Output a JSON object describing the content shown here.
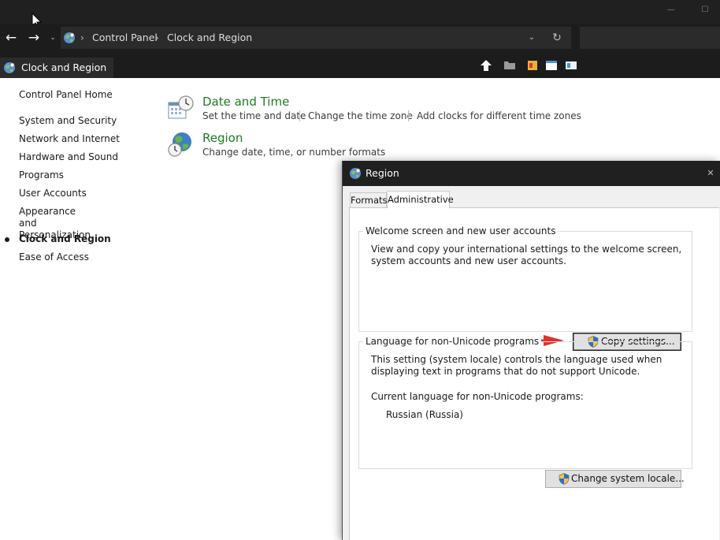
{
  "titlebar": {
    "minimize_glyph": "—",
    "maximize_glyph": "☐"
  },
  "nav": {
    "back_glyph": "←",
    "forward_glyph": "→",
    "recent_glyph": "⌄"
  },
  "address": {
    "icon": "control-panel-globe-icon",
    "separator": "›",
    "crumbs": [
      "Control Panel",
      "Clock and Region"
    ],
    "dropdown_glyph": "⌄",
    "refresh_glyph": "↻"
  },
  "tab": {
    "label": "Clock and Region",
    "icon": "control-panel-globe-icon"
  },
  "toolbar_icons": [
    "up-arrow-icon",
    "folder-icon",
    "flag-icon",
    "window-icon",
    "panel-icon"
  ],
  "sidebar": {
    "items": [
      {
        "label": "Control Panel Home",
        "current": false
      },
      {
        "label": "System and Security",
        "current": false
      },
      {
        "label": "Network and Internet",
        "current": false
      },
      {
        "label": "Hardware and Sound",
        "current": false
      },
      {
        "label": "Programs",
        "current": false
      },
      {
        "label": "User Accounts",
        "current": false
      },
      {
        "label": "Appearance and Personalization",
        "current": false
      },
      {
        "label": "Clock and Region",
        "current": true
      },
      {
        "label": "Ease of Access",
        "current": false
      }
    ]
  },
  "main": {
    "date_time": {
      "title": "Date and Time",
      "links": [
        "Set the time and date",
        "Change the time zone",
        "Add clocks for different time zones"
      ],
      "icon": "date-time-clock-icon"
    },
    "region": {
      "title": "Region",
      "links": [
        "Change date, time, or number formats"
      ],
      "icon": "region-globe-icon"
    }
  },
  "dialog": {
    "title": "Region",
    "close_glyph": "✕",
    "tabs": [
      {
        "label": "Formats",
        "active": false
      },
      {
        "label": "Administrative",
        "active": true
      }
    ],
    "welcome": {
      "legend": "Welcome screen and new user accounts",
      "text": "View and copy your international settings to the welcome screen, system accounts and new user accounts.",
      "button": "Copy settings..."
    },
    "nonunicode": {
      "legend": "Language for non-Unicode programs",
      "text": "This setting (system locale) controls the language used when displaying text in programs that do not support Unicode.",
      "current_label": "Current language for non-Unicode programs:",
      "current_value": "Russian (Russia)",
      "button": "Change system locale..."
    }
  },
  "colors": {
    "chrome_dark": "#202020",
    "category_green": "#1e7b23",
    "annotation_red": "#e03030"
  }
}
